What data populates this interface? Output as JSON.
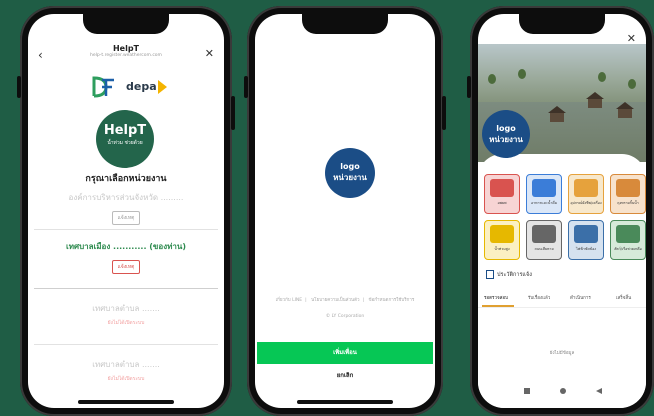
{
  "phone1": {
    "title": "HelpT",
    "url": "help-t.register.weathercom.com",
    "back_glyph": "‹",
    "close_glyph": "✕",
    "logo_depa": "depa",
    "helpt_name": "HelpT",
    "helpt_tagline": "น้ำท่วม ช่วยด้วย",
    "select_prompt": "กรุณาเลือกหน่วยงาน",
    "agencies": [
      {
        "name": "องค์การบริหารส่วนจังหวัด .........",
        "button": "แจ้งเหตุ"
      },
      {
        "name": "เทศบาลเมือง ........... (ของท่าน)",
        "button": "แจ้งเหตุ"
      },
      {
        "name": "เทศบาลตำบล .......",
        "button": "ยังไม่ได้เปิดระบบ"
      },
      {
        "name": "เทศบาลตำบล .......",
        "button": "ยังไม่ได้เปิดระบบ"
      }
    ]
  },
  "phone2": {
    "logo_line1": "logo",
    "logo_line2": "หน่วยงาน",
    "links": [
      "เกี่ยวกับ LINE",
      "นโยบายความเป็นส่วนตัว",
      "ข้อกำหนดการใช้บริการ"
    ],
    "corp": "© LY Corporation",
    "add_friend": "เพิ่มเพื่อน",
    "cancel": "ยกเลิก"
  },
  "phone3": {
    "close_glyph": "✕",
    "logo_line1": "logo",
    "logo_line2": "หน่วยงาน",
    "services": [
      {
        "label": "อพยพ",
        "color": "#d9534f",
        "bg": "#f7d4d4"
      },
      {
        "label": "อาหารและน้ำดื่ม",
        "color": "#3b7dd8",
        "bg": "#dbe7f7"
      },
      {
        "label": "อุปกรณ์ยังชีพ/เครื่อง",
        "color": "#e6a23c",
        "bg": "#f7e8cc"
      },
      {
        "label": "ถุงทรายกั้นน้ำ",
        "color": "#d88a3b",
        "bg": "#f7e2cc"
      },
      {
        "label": "น้ำท่วมสูง",
        "color": "#e6b800",
        "bg": "#fbf0c2"
      },
      {
        "label": "ถนนเสียหาย",
        "color": "#666",
        "bg": "#e4e4e4"
      },
      {
        "label": "ไฟฟ้าขัดข้อง",
        "color": "#3b6fa8",
        "bg": "#d6e2ef"
      },
      {
        "label": "สัตว์/เรือช่วยเหลือ",
        "color": "#4a8a5a",
        "bg": "#d6ead9"
      }
    ],
    "history_label": "ประวัติการแจ้ง",
    "tabs": [
      "รอตรวจสอบ",
      "รับเรื่องแล้ว",
      "ดำเนินการ",
      "เสร็จสิ้น"
    ],
    "empty_text": "ยังไม่มีข้อมูล"
  }
}
